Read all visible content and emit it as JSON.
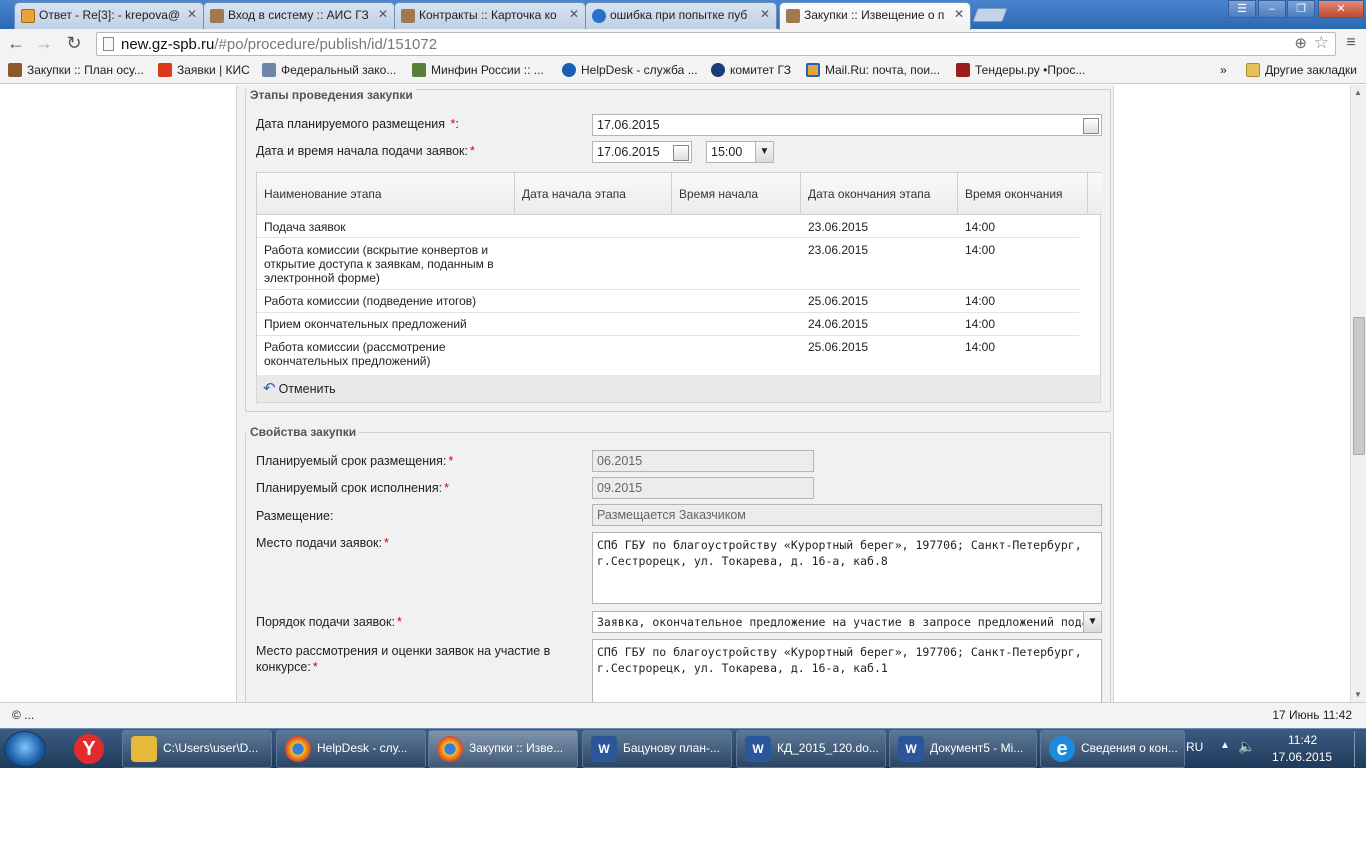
{
  "browser": {
    "tabs": [
      {
        "title": "Ответ - Re[3]: - krepova@",
        "color": "#e8a43a"
      },
      {
        "title": "Вход в систему :: АИС ГЗ",
        "color": "#8b5a2b"
      },
      {
        "title": "Контракты :: Карточка ко",
        "color": "#8b5a2b"
      },
      {
        "title": "ошибка при попытке пуб",
        "color": "#2a6fc9"
      },
      {
        "title": "Закупки :: Извещение о п",
        "color": "#8b5a2b",
        "active": true
      }
    ],
    "url_host": "new.gz-spb.ru",
    "url_path": "/#po/procedure/publish/id/151072",
    "bookmarks": [
      {
        "label": "Закупки :: План осу...",
        "color": "#8b5a2b"
      },
      {
        "label": "Заявки | КИС",
        "color": "#d83a1a"
      },
      {
        "label": "Федеральный зако...",
        "color": "#6e86a8"
      },
      {
        "label": "Минфин России :: ...",
        "color": "#5b7d3a"
      },
      {
        "label": "HelpDesk - служба ...",
        "color": "#1a5fb4"
      },
      {
        "label": "комитет ГЗ",
        "color": "#1a3d7a"
      },
      {
        "label": "Mail.Ru: почта, пои...",
        "color": "#1e63c6"
      },
      {
        "label": "Тендеры.ру •Прос...",
        "color": "#9a1d1d"
      }
    ],
    "bookmarks_more": "»",
    "other_bookmarks": "Другие закладки"
  },
  "stages": {
    "legend": "Этапы проведения закупки",
    "planned_date_label": "Дата планируемого размещения",
    "planned_date_value": "17.06.2015",
    "start_label": "Дата и время начала подачи заявок:",
    "start_date": "17.06.2015",
    "start_time": "15:00",
    "columns": [
      "Наименование этапа",
      "Дата начала этапа",
      "Время начала",
      "Дата окончания этапа",
      "Время окончания"
    ],
    "rows": [
      {
        "name": "Подача заявок",
        "start_date": "",
        "start_time": "",
        "end_date": "23.06.2015",
        "end_time": "14:00"
      },
      {
        "name": "Работа комиссии (вскрытие конвертов и открытие доступа к заявкам, поданным в электронной форме)",
        "start_date": "",
        "start_time": "",
        "end_date": "23.06.2015",
        "end_time": "14:00"
      },
      {
        "name": "Работа комиссии (подведение итогов)",
        "start_date": "",
        "start_time": "",
        "end_date": "25.06.2015",
        "end_time": "14:00"
      },
      {
        "name": "Прием окончательных предложений",
        "start_date": "",
        "start_time": "",
        "end_date": "24.06.2015",
        "end_time": "14:00"
      },
      {
        "name": "Работа комиссии (рассмотрение окончательных предложений)",
        "start_date": "",
        "start_time": "",
        "end_date": "25.06.2015",
        "end_time": "14:00"
      }
    ],
    "cancel_label": "Отменить"
  },
  "props": {
    "legend": "Свойства закупки",
    "placement_term_label": "Планируемый срок размещения:",
    "placement_term_value": "06.2015",
    "execution_term_label": "Планируемый срок исполнения:",
    "execution_term_value": "09.2015",
    "placement_label": "Размещение:",
    "placement_value": "Размещается Заказчиком",
    "submission_place_label": "Место подачи заявок:",
    "submission_place_value": "СПб ГБУ по благоустройству «Курортный берег», 197706; Санкт-Петербург, г.Сестрорецк, ул. Токарева, д. 16-а, каб.8",
    "submission_order_label": "Порядок подачи заявок:",
    "submission_order_value": "Заявка, окончательное предложение на участие в запросе предложений подает",
    "review_place_label": "Место рассмотрения и оценки заявок на участие в конкурсе:",
    "review_place_value": "СПб ГБУ по благоустройству «Курортный берег», 197706; Санкт-Петербург, г.Сестрорецк, ул. Токарева, д. 16-а, каб.1"
  },
  "status": {
    "left": "© ...",
    "right": "17 Июнь 11:42"
  },
  "taskbar": {
    "items": [
      {
        "label": "C:\\Users\\user\\D...",
        "color": "#e6b93c"
      },
      {
        "label": "HelpDesk - слу...",
        "color": "#d9432f"
      },
      {
        "label": "Закупки :: Изве...",
        "color": "#d9432f",
        "active": true
      },
      {
        "label": "Бацунову план-...",
        "color": "#2b579a"
      },
      {
        "label": "КД_2015_120.do...",
        "color": "#2b579a"
      },
      {
        "label": "Документ5 - Mi...",
        "color": "#2b579a"
      },
      {
        "label": "Сведения о кон...",
        "color": "#1b8be0"
      }
    ],
    "lang": "RU",
    "time": "11:42",
    "date": "17.06.2015"
  }
}
